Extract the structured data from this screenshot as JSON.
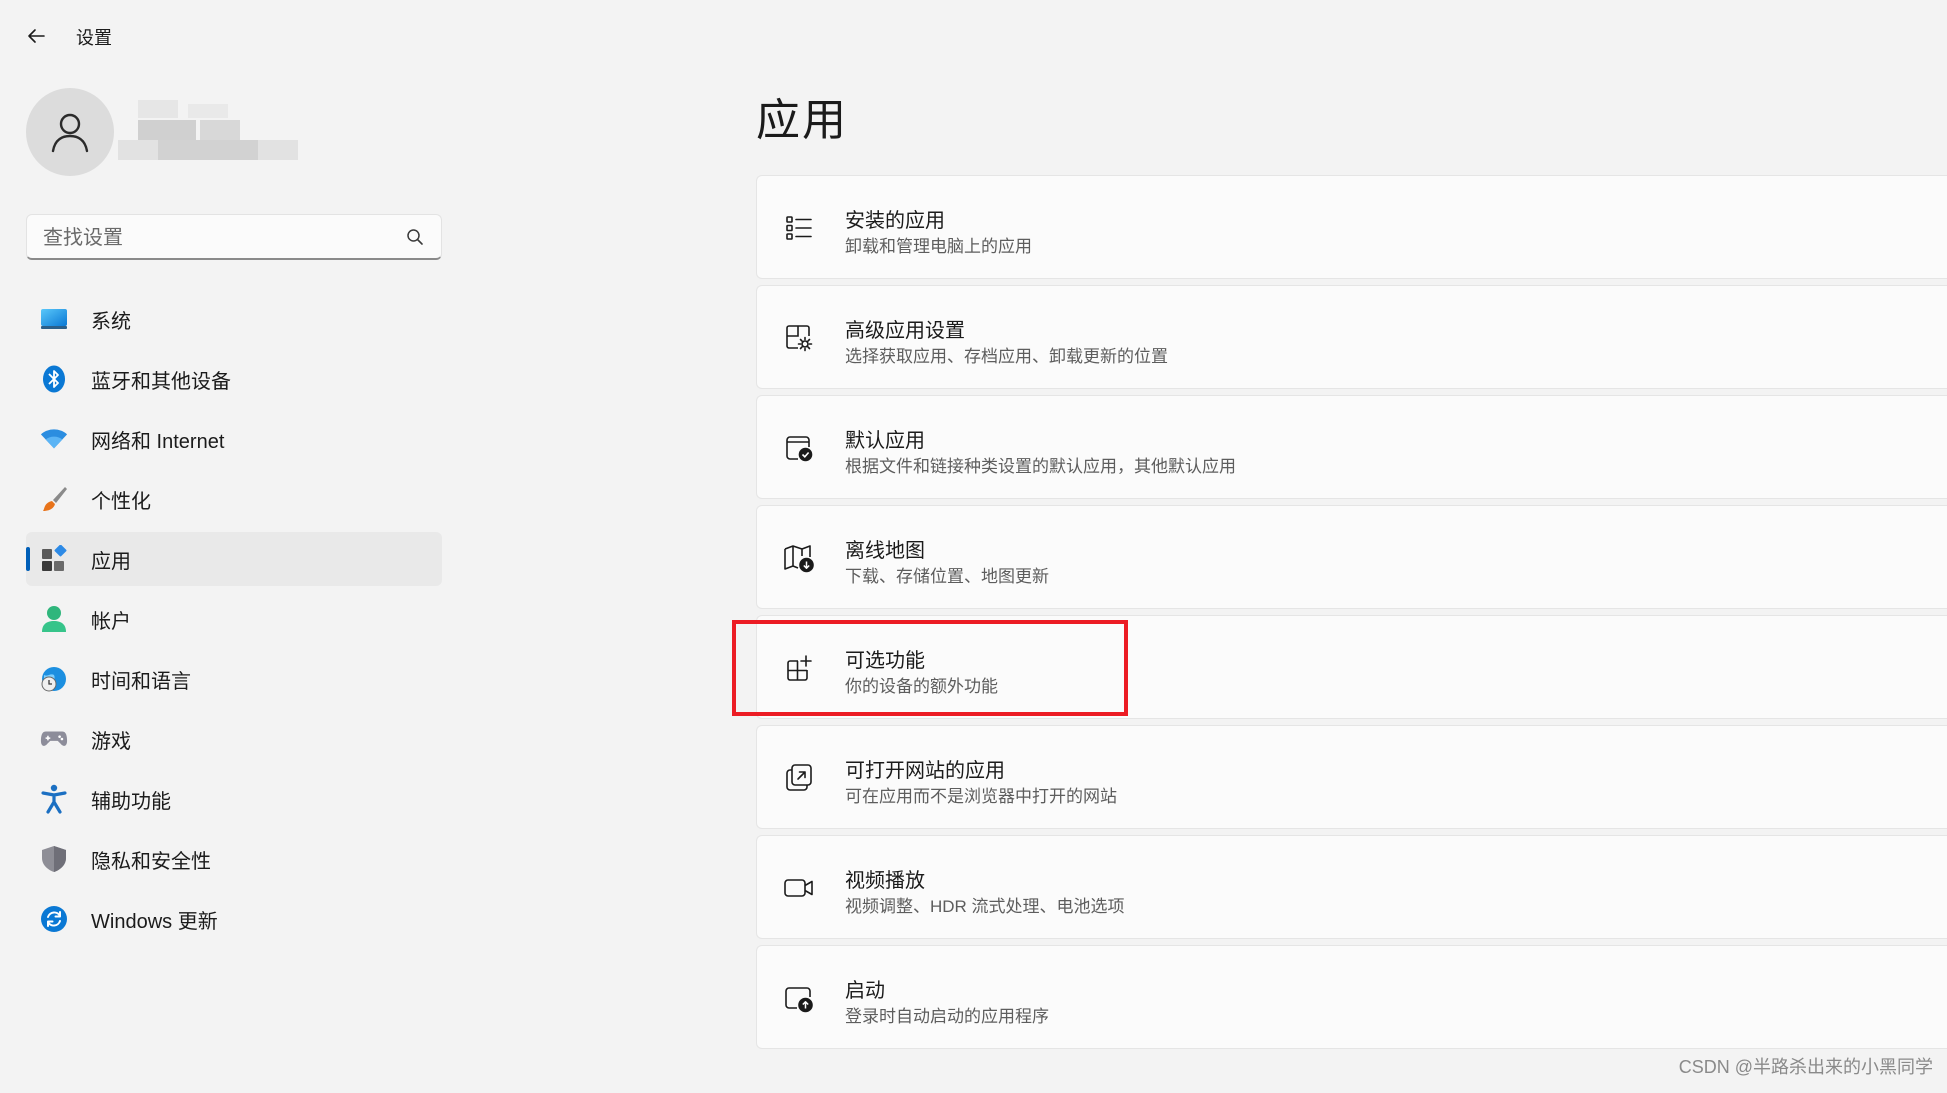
{
  "window": {
    "title": "设置"
  },
  "search": {
    "placeholder": "查找设置"
  },
  "nav": {
    "items": [
      {
        "label": "系统",
        "icon": "system-icon"
      },
      {
        "label": "蓝牙和其他设备",
        "icon": "bluetooth-icon"
      },
      {
        "label": "网络和 Internet",
        "icon": "wifi-icon"
      },
      {
        "label": "个性化",
        "icon": "brush-icon"
      },
      {
        "label": "应用",
        "icon": "apps-icon",
        "active": true
      },
      {
        "label": "帐户",
        "icon": "account-icon"
      },
      {
        "label": "时间和语言",
        "icon": "time-language-icon"
      },
      {
        "label": "游戏",
        "icon": "gamepad-icon"
      },
      {
        "label": "辅助功能",
        "icon": "accessibility-icon"
      },
      {
        "label": "隐私和安全性",
        "icon": "shield-icon"
      },
      {
        "label": "Windows 更新",
        "icon": "windows-update-icon"
      }
    ]
  },
  "main": {
    "title": "应用",
    "cards": [
      {
        "title": "安装的应用",
        "desc": "卸载和管理电脑上的应用",
        "icon": "list-icon"
      },
      {
        "title": "高级应用设置",
        "desc": "选择获取应用、存档应用、卸载更新的位置",
        "icon": "app-settings-icon"
      },
      {
        "title": "默认应用",
        "desc": "根据文件和链接种类设置的默认应用，其他默认应用",
        "icon": "default-apps-icon"
      },
      {
        "title": "离线地图",
        "desc": "下载、存储位置、地图更新",
        "icon": "map-download-icon"
      },
      {
        "title": "可选功能",
        "desc": "你的设备的额外功能",
        "icon": "add-feature-icon",
        "highlighted": true
      },
      {
        "title": "可打开网站的应用",
        "desc": "可在应用而不是浏览器中打开的网站",
        "icon": "open-link-icon"
      },
      {
        "title": "视频播放",
        "desc": "视频调整、HDR 流式处理、电池选项",
        "icon": "video-icon"
      },
      {
        "title": "启动",
        "desc": "登录时自动启动的应用程序",
        "icon": "startup-icon"
      }
    ]
  },
  "colors": {
    "accent": "#005fb8",
    "highlight_border": "#ec1c24",
    "background": "#f3f3f3",
    "card": "#fbfbfb"
  },
  "watermark": "CSDN @半路杀出来的小黑同学"
}
